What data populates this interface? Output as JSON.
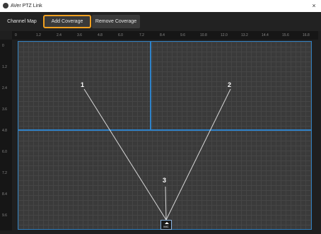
{
  "window": {
    "title": "AVer PTZ Link",
    "close_glyph": "×"
  },
  "toolbar": {
    "channel_map": "Channel Map",
    "add_coverage": "Add Coverage",
    "remove_coverage": "Remove Coverage"
  },
  "ruler": {
    "top": [
      "0",
      "1.2",
      "2.4",
      "3.6",
      "4.8",
      "6.0",
      "7.2",
      "8.4",
      "9.6",
      "10.8",
      "12.0",
      "13.2",
      "14.4",
      "15.6",
      "16.8"
    ],
    "left": [
      "0",
      "1.2",
      "2.4",
      "3.6",
      "4.8",
      "6.0",
      "7.2",
      "8.4",
      "9.6"
    ]
  },
  "beams": [
    {
      "label": "1"
    },
    {
      "label": "2"
    },
    {
      "label": "3"
    }
  ],
  "mic": {
    "label": "MIC"
  },
  "colors": {
    "accent": "#f0a020",
    "zone_border": "#2f82c8",
    "map_bg": "#3a3a3a"
  }
}
